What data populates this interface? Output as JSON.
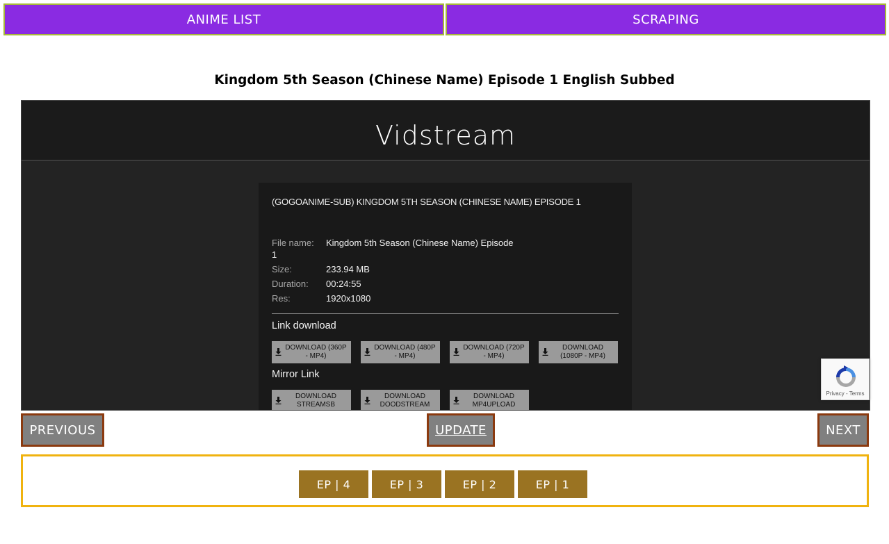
{
  "nav": {
    "anime_list": "ANIME LIST",
    "scraping": "SCRAPING"
  },
  "page_title": "Kingdom 5th Season (Chinese Name) Episode 1 English Subbed",
  "player": {
    "logo_vid": "Vid",
    "logo_stream": "stream",
    "panel_title": "(GOGOANIME-SUB) KINGDOM 5TH SEASON (CHINESE NAME) EPISODE 1",
    "info": [
      {
        "label": "File name:",
        "value_line1": "Kingdom 5th Season (Chinese Name) Episode",
        "value_line2": "1"
      },
      {
        "label": "Size:",
        "value": "233.94 MB"
      },
      {
        "label": "Duration:",
        "value": "00:24:55"
      },
      {
        "label": "Res:",
        "value": "1920x1080"
      }
    ],
    "link_download_label": "Link download",
    "downloads": [
      "DOWNLOAD (360P - MP4)",
      "DOWNLOAD (480P - MP4)",
      "DOWNLOAD (720P - MP4)",
      "DOWNLOAD (1080P - MP4)"
    ],
    "mirror_link_label": "Mirror Link",
    "mirrors": [
      "DOWNLOAD STREAMSB",
      "DOWNLOAD DOODSTREAM",
      "DOWNLOAD MP4UPLOAD"
    ]
  },
  "recaptcha": {
    "terms": "Privacy - Terms",
    "icon": "recaptcha-icon"
  },
  "controls": {
    "previous": "PREVIOUS",
    "update": "UPDATE",
    "next": "NEXT"
  },
  "episodes": [
    "EP | 4",
    "EP | 3",
    "EP | 2",
    "EP | 1"
  ],
  "colors": {
    "nav_bg": "#8a2be2",
    "nav_border": "#a6b83a",
    "control_bg": "#808080",
    "control_border": "#8b3a0f",
    "episode_bg": "#9a7322",
    "episode_border": "#f0b30f"
  }
}
